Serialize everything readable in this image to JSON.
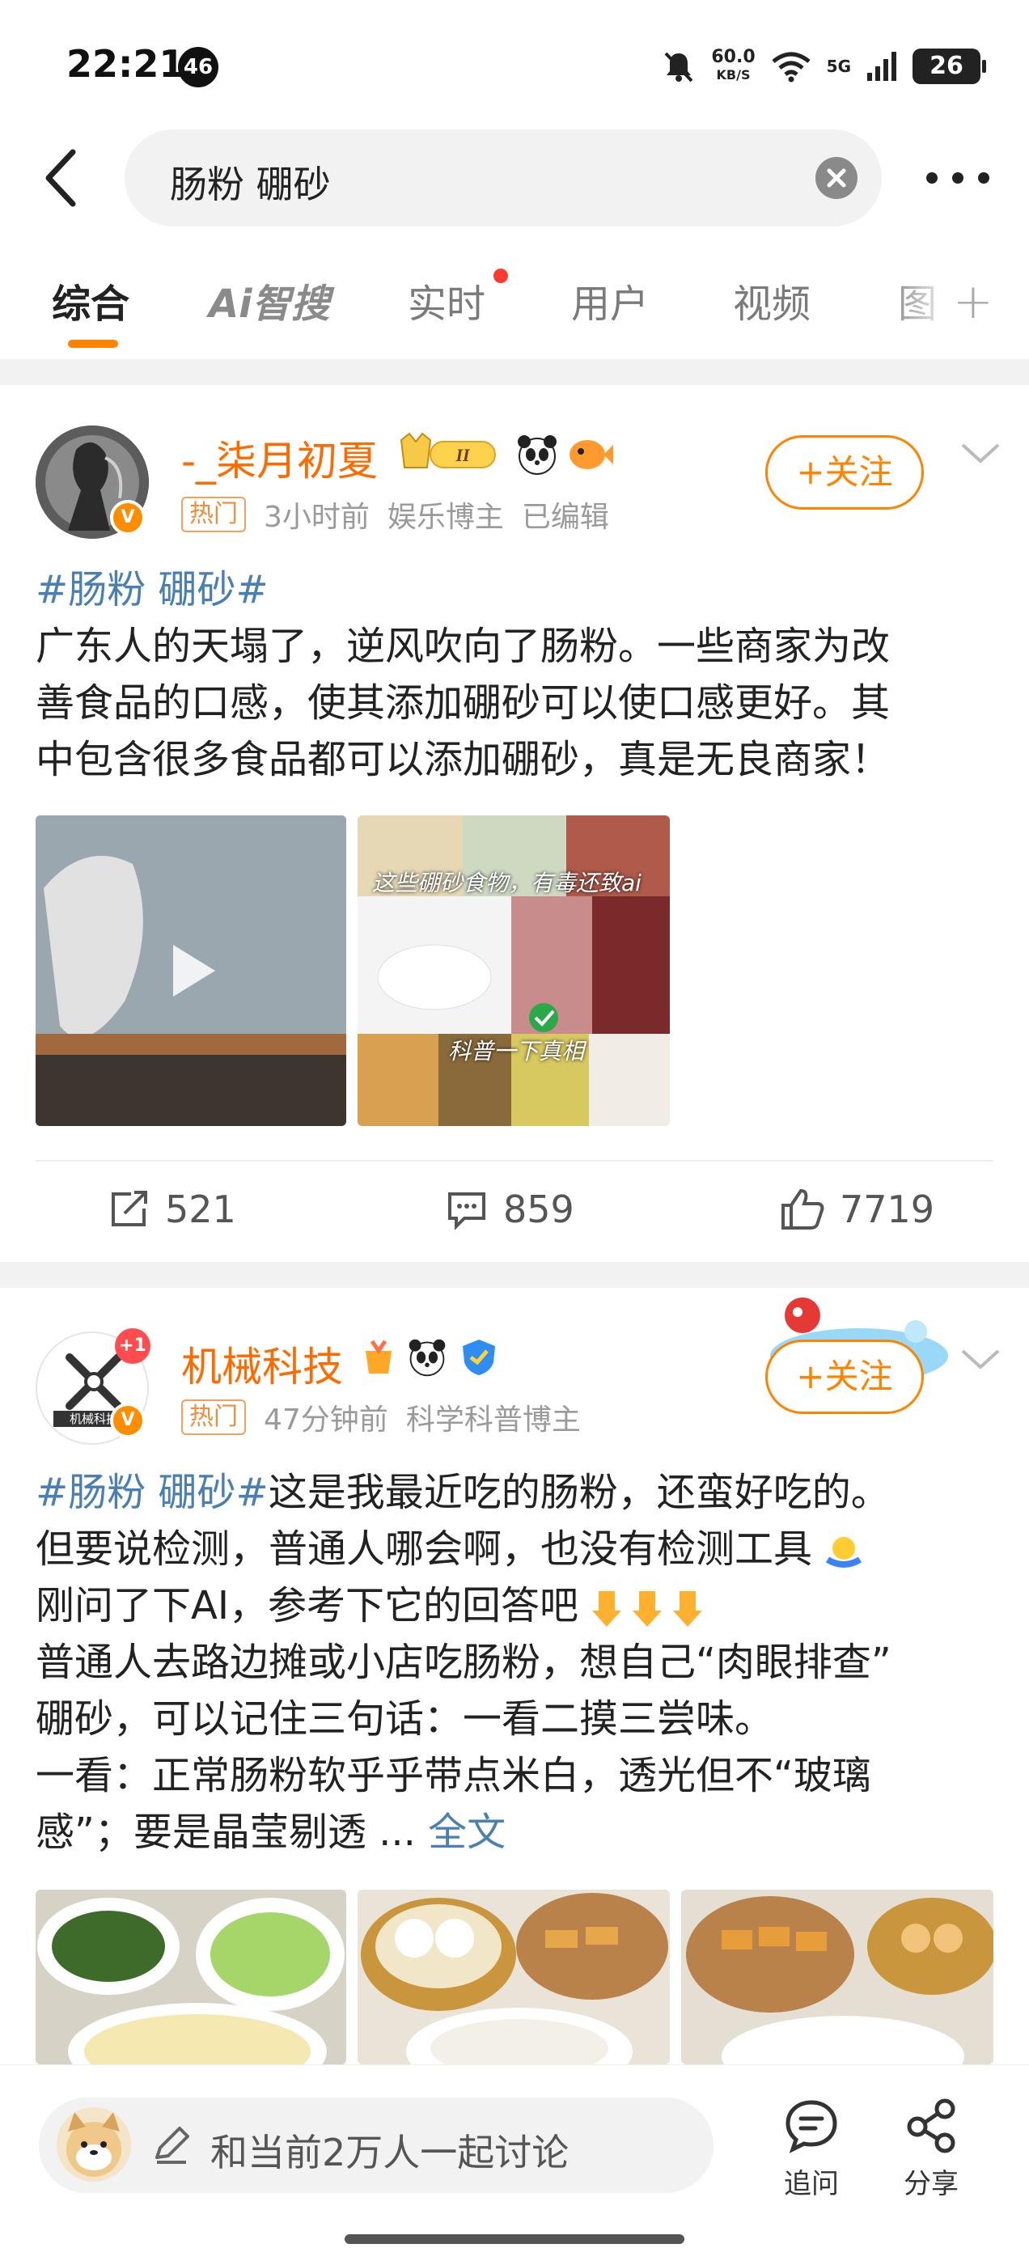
{
  "status_bar": {
    "time": "22:21",
    "notification_count": "46",
    "speed_value": "60.0",
    "speed_unit": "KB/S",
    "network": "5G",
    "battery": "26"
  },
  "search": {
    "query": "肠粉 硼砂"
  },
  "tabs": [
    {
      "label": "综合",
      "active": true
    },
    {
      "label": "Ai智搜",
      "active": false
    },
    {
      "label": "实时",
      "active": false,
      "has_dot": true
    },
    {
      "label": "用户",
      "active": false
    },
    {
      "label": "视频",
      "active": false
    },
    {
      "label": "图",
      "active": false
    }
  ],
  "colors": {
    "accent": "#ff8200",
    "username": "#ff6a00",
    "link": "#4a7fb3",
    "band": "#f2f2f2"
  },
  "posts": [
    {
      "username": "-_柒月初夏",
      "level_badge": "II",
      "hot_tag": "热门",
      "time": "3小时前",
      "role": "娱乐博主",
      "edited": "已编辑",
      "follow_label": "+关注",
      "hashtag": "#肠粉 硼砂#",
      "text_lines": [
        "广东人的天塌了，逆风吹向了肠粉。一些商家为改",
        "善食品的口感，使其添加硼砂可以使口感更好。其",
        "中包含很多食品都可以添加硼砂，真是无良商家！"
      ],
      "image2_caption_top": "这些硼砂食物，有毒还致ai",
      "image2_caption_bottom": "科普一下真相",
      "reposts": "521",
      "comments": "859",
      "likes": "7719"
    },
    {
      "username": "机械科技",
      "avatar_badge": "+1",
      "avatar_logo_text": "机械科技",
      "hot_tag": "热门",
      "time": "47分钟前",
      "role": "科学科普博主",
      "follow_label": "+关注",
      "hashtag": "#肠粉 硼砂#",
      "line1_rest": "这是我最近吃的肠粉，还蛮好吃的。",
      "lines": [
        "但要说检测，普通人哪会啊，也没有检测工具",
        "刚问了下AI，参考下它的回答吧",
        "普通人去路边摊或小店吃肠粉，想自己“肉眼排查”",
        "硼砂，可以记住三句话：一看二摸三尝味。",
        "一看：正常肠粉软乎乎带点米白，透光但不“玻璃",
        "感”；要是晶莹剔透 ... "
      ],
      "full_text_link": "全文"
    }
  ],
  "bottom_bar": {
    "discuss_placeholder": "和当前2万人一起讨论",
    "ask_label": "追问",
    "share_label": "分享"
  }
}
